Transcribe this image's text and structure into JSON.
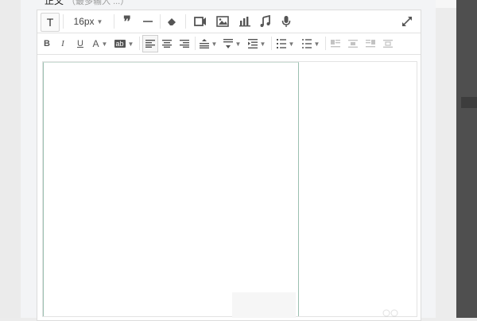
{
  "field": {
    "label": "正文",
    "hint": "（最多输入 ...）"
  },
  "toolbar": {
    "row1": {
      "text_button_label": "T",
      "font_size": "16px",
      "icons": [
        "quote-icon",
        "horizontal-rule-icon",
        "eraser-icon",
        "video-icon",
        "image-icon",
        "chart-icon",
        "music-icon",
        "microphone-icon",
        "expand-icon"
      ]
    },
    "row2": {
      "bold_label": "B",
      "italic_label": "I",
      "underline_label": "U",
      "font_color_label": "A",
      "highlight_label": "ab"
    }
  },
  "colors": {
    "accent_border": "#9bbfb0",
    "toolbar_icon": "#555555",
    "background": "#f3f4f6"
  }
}
